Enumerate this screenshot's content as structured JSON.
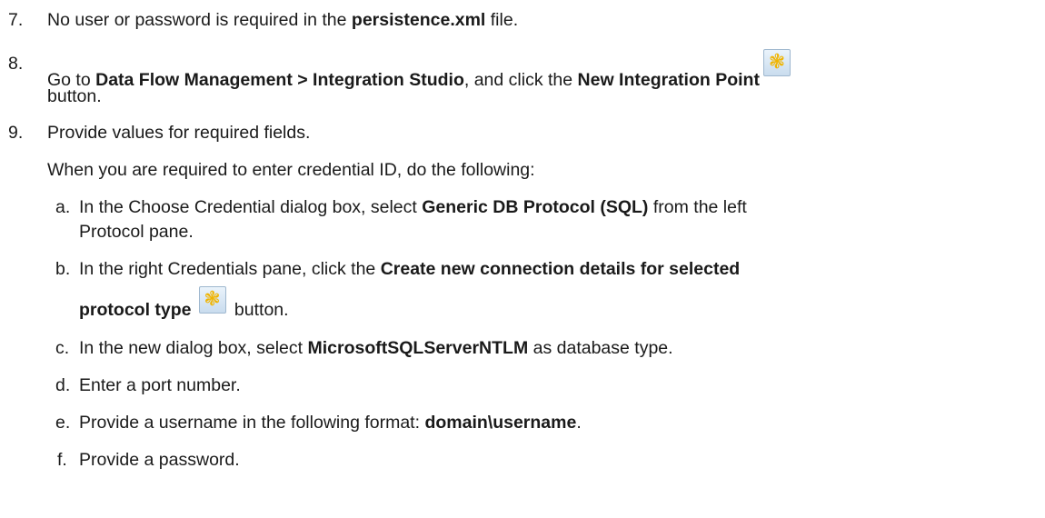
{
  "steps": [
    {
      "num": "7.",
      "pre": "No user or password is required in the ",
      "bold": "persistence.xml",
      "post": " file."
    },
    {
      "num": "8.",
      "pre": "Go to ",
      "bold1": "Data Flow Management > Integration Studio",
      "mid": ", and click the ",
      "bold2": "New Integration Point",
      "cont": "button."
    },
    {
      "num": "9.",
      "text": "Provide values for required fields.",
      "note": "When you are required to enter credential ID, do the following:"
    }
  ],
  "substeps": [
    {
      "letter": "a.",
      "pre": "In the Choose Credential dialog box, select ",
      "bold": "Generic DB Protocol (SQL)",
      "post": " from the left",
      "cont": "Protocol pane."
    },
    {
      "letter": "b.",
      "pre": "In the right Credentials pane, click the ",
      "bold": "Create new connection details for selected",
      "bold_cont": "protocol type",
      "post_cont": " button."
    },
    {
      "letter": "c.",
      "pre": "In the new dialog box, select ",
      "bold": "MicrosoftSQLServerNTLM",
      "post": " as database type."
    },
    {
      "letter": "d.",
      "text": "Enter a port number."
    },
    {
      "letter": "e.",
      "pre": "Provide a username in the following format: ",
      "bold": "domain\\username",
      "post": "."
    },
    {
      "letter": "f.",
      "text": "Provide a password."
    }
  ],
  "icons": {
    "new_item": "asterisk-new-icon"
  }
}
